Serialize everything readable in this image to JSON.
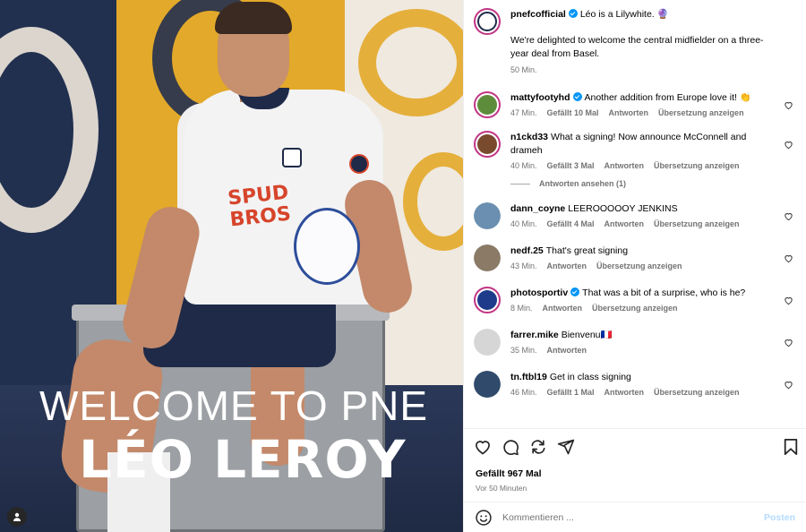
{
  "post": {
    "overlay_line1": "WELCOME TO PNE",
    "overlay_line2": "LÉO LEROY",
    "sponsor": "SPUD BROS"
  },
  "caption": {
    "username": "pnefcofficial",
    "text": "Léo is a Lilywhite. 🔮",
    "body": "We're delighted to welcome the central midfielder on a three-year deal from Basel.",
    "time": "50 Min."
  },
  "comments": [
    {
      "username": "mattyfootyhd",
      "verified": true,
      "text": "Another addition from Europe love it! 👏",
      "time": "47 Min.",
      "likes": "Gefällt 10 Mal",
      "reply": "Antworten",
      "translate": "Übersetzung anzeigen",
      "avatar_color": "#5d8c3a"
    },
    {
      "username": "n1ckd33",
      "verified": false,
      "text": "What a signing! Now announce McConnell and drameh",
      "time": "40 Min.",
      "likes": "Gefällt 3 Mal",
      "reply": "Antworten",
      "translate": "Übersetzung anzeigen",
      "avatar_color": "#7a4a2e",
      "view_replies": "Antworten ansehen (1)"
    },
    {
      "username": "dann_coyne",
      "verified": false,
      "text": "LEEROOOOOY JENKINS",
      "time": "40 Min.",
      "likes": "Gefällt 4 Mal",
      "reply": "Antworten",
      "translate": "Übersetzung anzeigen",
      "avatar_color": "#6b8fb0"
    },
    {
      "username": "nedf.25",
      "verified": false,
      "text": "That's great signing",
      "time": "43 Min.",
      "likes": "",
      "reply": "Antworten",
      "translate": "Übersetzung anzeigen",
      "avatar_color": "#8a7a66"
    },
    {
      "username": "photosportiv",
      "verified": true,
      "text": "That was a bit of a surprise, who is he?",
      "time": "8 Min.",
      "likes": "",
      "reply": "Antworten",
      "translate": "Übersetzung anzeigen",
      "avatar_color": "#1e3a8a"
    },
    {
      "username": "farrer.mike",
      "verified": false,
      "text": "Bienvenu🇫🇷",
      "time": "35 Min.",
      "likes": "",
      "reply": "Antworten",
      "translate": "",
      "avatar_color": "#d6d6d6"
    },
    {
      "username": "tn.ftbl19",
      "verified": false,
      "text": "Get in class signing",
      "time": "46 Min.",
      "likes": "Gefällt 1 Mal",
      "reply": "Antworten",
      "translate": "Übersetzung anzeigen",
      "avatar_color": "#2f4a6b"
    }
  ],
  "footer": {
    "likes": "Gefällt 967 Mal",
    "ago": "Vor 50 Minuten",
    "comment_placeholder": "Kommentieren ...",
    "post_label": "Posten"
  },
  "icons": [
    "heart-icon",
    "comment-icon",
    "share-icon",
    "send-icon",
    "bookmark-icon",
    "emoji-icon",
    "user-tag-icon",
    "verified-icon"
  ],
  "colors": {
    "verified": "#0095f6",
    "post_button": "#b3dbff",
    "muted": "#737373",
    "pne_navy": "#1e2a48",
    "pne_gold": "#e3a92a"
  }
}
